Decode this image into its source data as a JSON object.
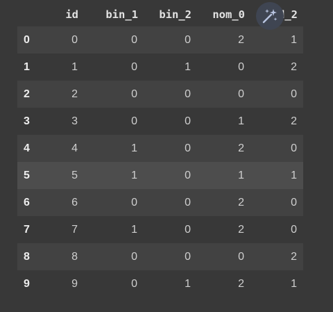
{
  "table": {
    "columns": [
      "id",
      "bin_1",
      "bin_2",
      "nom_0",
      "ord_2"
    ],
    "rows": [
      {
        "index": "0",
        "values": [
          "0",
          "0",
          "0",
          "2",
          "1"
        ]
      },
      {
        "index": "1",
        "values": [
          "1",
          "0",
          "1",
          "0",
          "2"
        ]
      },
      {
        "index": "2",
        "values": [
          "2",
          "0",
          "0",
          "0",
          "0"
        ]
      },
      {
        "index": "3",
        "values": [
          "3",
          "0",
          "0",
          "1",
          "2"
        ]
      },
      {
        "index": "4",
        "values": [
          "4",
          "1",
          "0",
          "2",
          "0"
        ]
      },
      {
        "index": "5",
        "values": [
          "5",
          "1",
          "0",
          "1",
          "1"
        ]
      },
      {
        "index": "6",
        "values": [
          "6",
          "0",
          "0",
          "2",
          "0"
        ]
      },
      {
        "index": "7",
        "values": [
          "7",
          "1",
          "0",
          "2",
          "0"
        ]
      },
      {
        "index": "8",
        "values": [
          "8",
          "0",
          "0",
          "0",
          "2"
        ]
      },
      {
        "index": "9",
        "values": [
          "9",
          "0",
          "1",
          "2",
          "1"
        ]
      }
    ],
    "hover_row": 5
  },
  "toolbar": {
    "magic_icon": "magic-wand-icon"
  },
  "colors": {
    "background": "#383838",
    "row_stripe": "#424242",
    "row_hover": "#4d4d4d",
    "magic_button_bg": "#3f4552",
    "magic_icon": "#b8c4e0"
  }
}
